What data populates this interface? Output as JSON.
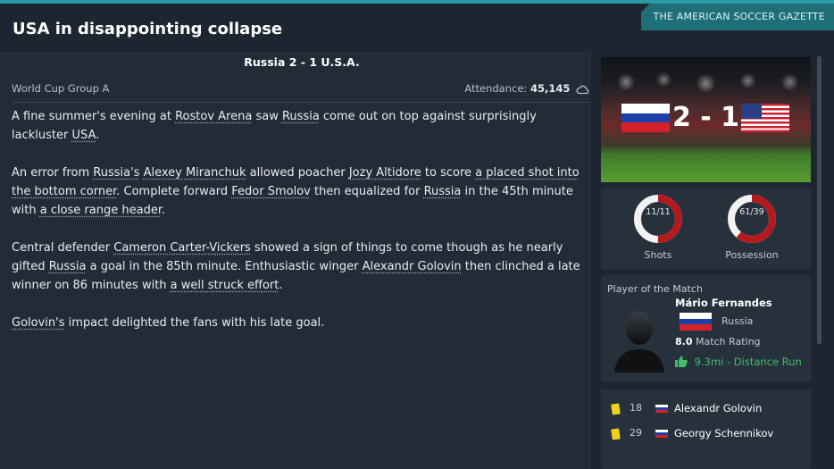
{
  "header": {
    "headline": "USA in disappointing collapse",
    "source": "THE AMERICAN SOCCER GAZETTE"
  },
  "match": {
    "title": "Russia 2 - 1  U.S.A.",
    "competition": "World Cup Group A",
    "attendance_label": "Attendance:",
    "attendance_value": "45,145",
    "score": "2 - 1",
    "home_team": "Russia",
    "away_team": "U.S.A."
  },
  "article": {
    "p1": [
      {
        "t": "A fine summer's evening at "
      },
      {
        "t": "Rostov Arena",
        "link": true
      },
      {
        "t": " saw "
      },
      {
        "t": "Russia",
        "link": true
      },
      {
        "t": " come out on top against surprisingly lackluster "
      },
      {
        "t": "USA",
        "link": true
      },
      {
        "t": "."
      }
    ],
    "p2": [
      {
        "t": "An error from "
      },
      {
        "t": "Russia's",
        "link": true
      },
      {
        "t": " "
      },
      {
        "t": "Alexey Miranchuk",
        "link": true
      },
      {
        "t": " allowed poacher "
      },
      {
        "t": "Jozy Altidore",
        "link": true
      },
      {
        "t": " to score "
      },
      {
        "t": "a placed shot into the bottom corner",
        "link": true
      },
      {
        "t": ". Complete forward "
      },
      {
        "t": "Fedor Smolov",
        "link": true
      },
      {
        "t": " then equalized for "
      },
      {
        "t": "Russia",
        "link": true
      },
      {
        "t": " in the 45th minute with "
      },
      {
        "t": "a close range header",
        "link": true
      },
      {
        "t": "."
      }
    ],
    "p3": [
      {
        "t": "Central defender "
      },
      {
        "t": "Cameron Carter-Vickers",
        "link": true
      },
      {
        "t": " showed a sign of things to come though as he nearly gifted "
      },
      {
        "t": "Russia",
        "link": true
      },
      {
        "t": " a goal in the 85th minute. Enthusiastic winger "
      },
      {
        "t": "Alexandr Golovin",
        "link": true
      },
      {
        "t": " then clinched a late winner on 86 minutes with "
      },
      {
        "t": "a well struck effort",
        "link": true
      },
      {
        "t": "."
      }
    ],
    "p4": [
      {
        "t": "Golovin's",
        "link": true
      },
      {
        "t": " impact delighted the fans with his late goal."
      }
    ]
  },
  "stats": {
    "shots_value": "11/11",
    "shots_label": "Shots",
    "shots_home_fraction": 0.5,
    "possession_value": "61/39",
    "possession_label": "Possession",
    "possession_home_fraction": 0.61,
    "home_color": "#b5191e",
    "away_color": "#f2f2f2"
  },
  "potm": {
    "title": "Player of the Match",
    "name": "Mário Fernandes",
    "nation": "Russia",
    "rating_value": "8.0",
    "rating_label": "Match Rating",
    "distance": "9.3mi - Distance Run"
  },
  "events": [
    {
      "minute": "18",
      "player": "Alexandr Golovin",
      "card": "yellow"
    },
    {
      "minute": "29",
      "player": "Georgy Schennikov",
      "card": "yellow"
    }
  ]
}
